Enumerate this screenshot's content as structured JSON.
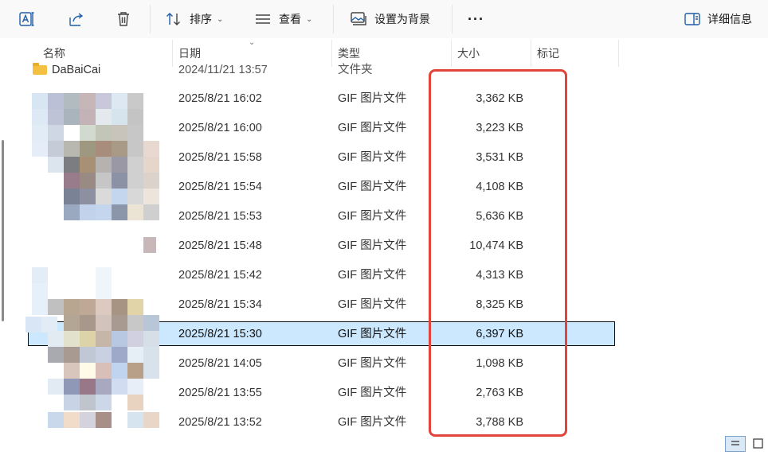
{
  "toolbar": {
    "sort_label": "排序",
    "view_label": "查看",
    "set_bg_label": "设置为背景",
    "more_label": "···",
    "details_label": "详细信息"
  },
  "columns": {
    "name": "名称",
    "date": "日期",
    "type": "类型",
    "size": "大小",
    "tags": "标记"
  },
  "rows": [
    {
      "name": "DaBaiCai",
      "date": "2024/11/21 13:57",
      "type": "文件夹",
      "size": ""
    },
    {
      "name": "",
      "date": "2025/8/21 16:02",
      "type": "GIF 图片文件",
      "size": "3,362 KB"
    },
    {
      "name": "",
      "date": "2025/8/21 16:00",
      "type": "GIF 图片文件",
      "size": "3,223 KB"
    },
    {
      "name": "",
      "date": "2025/8/21 15:58",
      "type": "GIF 图片文件",
      "size": "3,531 KB"
    },
    {
      "name": "",
      "date": "2025/8/21 15:54",
      "type": "GIF 图片文件",
      "size": "4,108 KB"
    },
    {
      "name": "",
      "date": "2025/8/21 15:53",
      "type": "GIF 图片文件",
      "size": "5,636 KB"
    },
    {
      "name": "",
      "date": "2025/8/21 15:48",
      "type": "GIF 图片文件",
      "size": "10,474 KB"
    },
    {
      "name": "",
      "date": "2025/8/21 15:42",
      "type": "GIF 图片文件",
      "size": "4,313 KB"
    },
    {
      "name": "",
      "date": "2025/8/21 15:34",
      "type": "GIF 图片文件",
      "size": "8,325 KB"
    },
    {
      "name": "",
      "date": "2025/8/21 15:30",
      "type": "GIF 图片文件",
      "size": "6,397 KB"
    },
    {
      "name": "",
      "date": "2025/8/21 14:05",
      "type": "GIF 图片文件",
      "size": "1,098 KB"
    },
    {
      "name": "",
      "date": "2025/8/21 13:55",
      "type": "GIF 图片文件",
      "size": "2,763 KB"
    },
    {
      "name": "",
      "date": "2025/8/21 13:52",
      "type": "GIF 图片文件",
      "size": "3,788 KB"
    }
  ],
  "colors": {
    "selection": "#cce8ff",
    "annotation": "#e0443a",
    "toolbar_bg": "#f9f9f9"
  },
  "icons": [
    "ai-rename-icon",
    "share-icon",
    "trash-icon",
    "sort-icon",
    "view-icon",
    "set-background-icon",
    "more-icon",
    "details-pane-icon",
    "folder-icon"
  ]
}
